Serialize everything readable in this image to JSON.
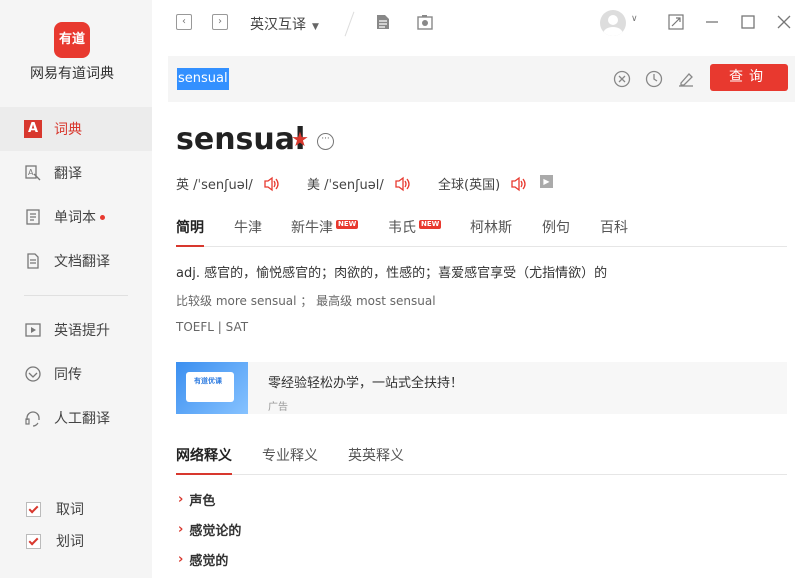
{
  "app": {
    "logo_text": "有道",
    "name": "网易有道词典",
    "brand_color": "#e8392f"
  },
  "sidebar": {
    "items": [
      {
        "label": "词典",
        "icon": "dictionary-icon",
        "active": true
      },
      {
        "label": "翻译",
        "icon": "translate-icon"
      },
      {
        "label": "单词本",
        "icon": "wordbook-icon",
        "dot": true
      },
      {
        "label": "文档翻译",
        "icon": "document-icon"
      },
      {
        "label": "英语提升",
        "icon": "video-icon"
      },
      {
        "label": "同传",
        "icon": "interpret-icon"
      },
      {
        "label": "人工翻译",
        "icon": "headset-icon"
      }
    ],
    "checks": [
      {
        "label": "取词",
        "checked": true
      },
      {
        "label": "划词",
        "checked": true
      }
    ]
  },
  "topbar": {
    "back": "‹",
    "forward": "›",
    "mode": "英汉互译"
  },
  "search": {
    "query": "sensual",
    "button": "查询"
  },
  "entry": {
    "word": "sensual",
    "star": "★",
    "more": "···",
    "pron": [
      {
        "label": "英 /ˈsenʃuəl/"
      },
      {
        "label": "美 /ˈsenʃuəl/"
      },
      {
        "label": "全球(英国)"
      }
    ]
  },
  "tabs": [
    {
      "label": "简明",
      "active": true
    },
    {
      "label": "牛津"
    },
    {
      "label": "新牛津",
      "badge": "NEW"
    },
    {
      "label": "韦氏",
      "badge": "NEW"
    },
    {
      "label": "柯林斯"
    },
    {
      "label": "例句"
    },
    {
      "label": "百科"
    }
  ],
  "definition": {
    "meaning": "adj. 感官的，愉悦感官的；肉欲的，性感的；喜爱感官享受（尤指情欲）的",
    "forms": "比较级 more sensual ；  最高级 most sensual",
    "exams": "TOEFL | SAT"
  },
  "ad": {
    "image_text": "有道优课",
    "title": "零经验轻松办学，一站式全扶持！",
    "label": "广告"
  },
  "tabs2": [
    {
      "label": "网络释义",
      "active": true
    },
    {
      "label": "专业释义"
    },
    {
      "label": "英英释义"
    }
  ],
  "net_items": [
    "声色",
    "感觉论的",
    "感觉的"
  ]
}
